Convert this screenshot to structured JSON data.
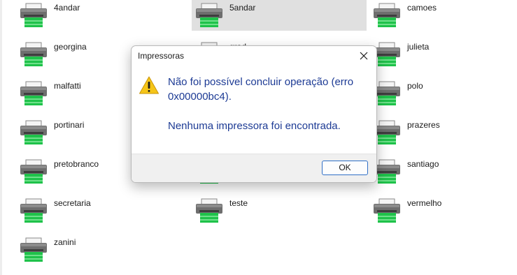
{
  "printers": [
    {
      "name": "4andar",
      "selected": false
    },
    {
      "name": "5andar",
      "selected": true
    },
    {
      "name": "camoes",
      "selected": false
    },
    {
      "name": "georgina",
      "selected": false
    },
    {
      "name": "grad",
      "selected": false
    },
    {
      "name": "julieta",
      "selected": false
    },
    {
      "name": "malfatti",
      "selected": false
    },
    {
      "name": "",
      "selected": false
    },
    {
      "name": "polo",
      "selected": false
    },
    {
      "name": "portinari",
      "selected": false
    },
    {
      "name": "",
      "selected": false
    },
    {
      "name": "prazeres",
      "selected": false
    },
    {
      "name": "pretobranco",
      "selected": false
    },
    {
      "name": "",
      "selected": false
    },
    {
      "name": "santiago",
      "selected": false
    },
    {
      "name": "secretaria",
      "selected": false
    },
    {
      "name": "teste",
      "selected": false
    },
    {
      "name": "vermelho",
      "selected": false
    },
    {
      "name": "zanini",
      "selected": false
    }
  ],
  "dialog": {
    "title": "Impressoras",
    "message": "Não foi possível concluir operação (erro 0x00000bc4).",
    "detail": "Nenhuma impressora foi encontrada.",
    "ok_label": "OK",
    "icon": "warning-icon",
    "close_icon": "close-icon"
  },
  "colors": {
    "message_text": "#1c3a94",
    "selection": "#e0e0e0",
    "printer_green": "#1fc24a",
    "warning_yellow": "#f5c518",
    "button_border": "#2f6fc6"
  }
}
